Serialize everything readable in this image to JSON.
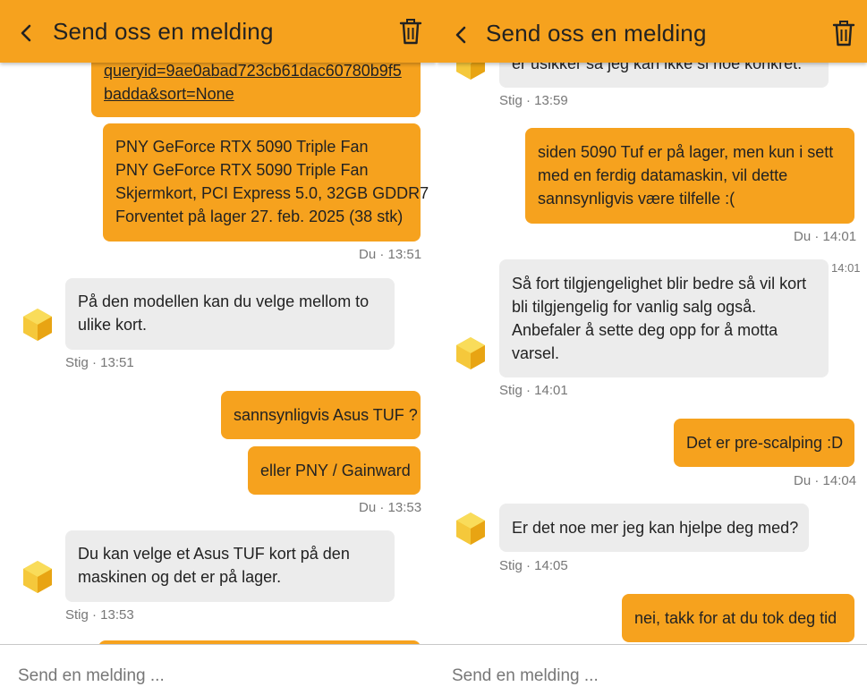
{
  "header": {
    "title": "Send oss en melding"
  },
  "input": {
    "placeholder": "Send en melding ..."
  },
  "colors": {
    "header": "#f6a21e",
    "outgoing_bubble": "#f6a21e",
    "incoming_bubble": "#ececec"
  },
  "icons": {
    "back": "chevron-left-icon",
    "delete": "trash-icon",
    "avatar": "agent-cube-icon"
  },
  "left": {
    "link_lines": [
      "queryid=9ae0abad723cb61dac60780b9f5",
      "badda&sort=None"
    ],
    "product_lines": [
      "PNY GeForce RTX 5090 Triple Fan",
      "PNY GeForce RTX 5090 Triple Fan",
      "Skjermkort, PCI Express 5.0, 32GB GDDR7",
      "Forventet på lager 27. feb. 2025 (38 stk)"
    ],
    "meta_1": "Du · 13:51",
    "agent_msg_1": [
      "På den modellen kan du velge mellom to",
      "ulike kort."
    ],
    "meta_2": "Stig · 13:51",
    "user_msg_1": "sannsynligvis Asus TUF ?",
    "user_msg_2": "eller PNY / Gainward",
    "meta_3": "Du · 13:53",
    "agent_msg_2": [
      "Du kan velge et Asus TUF kort på den",
      "maskinen og det er på lager."
    ],
    "meta_4": "Stig · 13:53"
  },
  "right": {
    "agent_msg_0": "er usikker så jeg kan ikke si noe konkret.",
    "meta_0": "Stig · 13:59",
    "user_msg_1": [
      "siden 5090 Tuf er på lager, men kun i sett",
      "med en ferdig datamaskin, vil dette",
      "sannsynligvis være tilfelle :("
    ],
    "meta_1": "Du · 14:01",
    "stray_time": "14:01",
    "agent_msg_1": [
      "Så fort tilgjengelighet blir bedre så vil kort",
      "bli tilgjengelig for vanlig salg også.",
      "Anbefaler å sette deg opp for å motta",
      "varsel."
    ],
    "meta_2": "Stig · 14:01",
    "user_msg_2": "Det er pre-scalping :D",
    "meta_3": "Du · 14:04",
    "agent_msg_2": "Er det noe mer jeg kan hjelpe deg med?",
    "meta_4": "Stig · 14:05",
    "user_msg_3": "nei, takk for at du tok deg tid"
  }
}
